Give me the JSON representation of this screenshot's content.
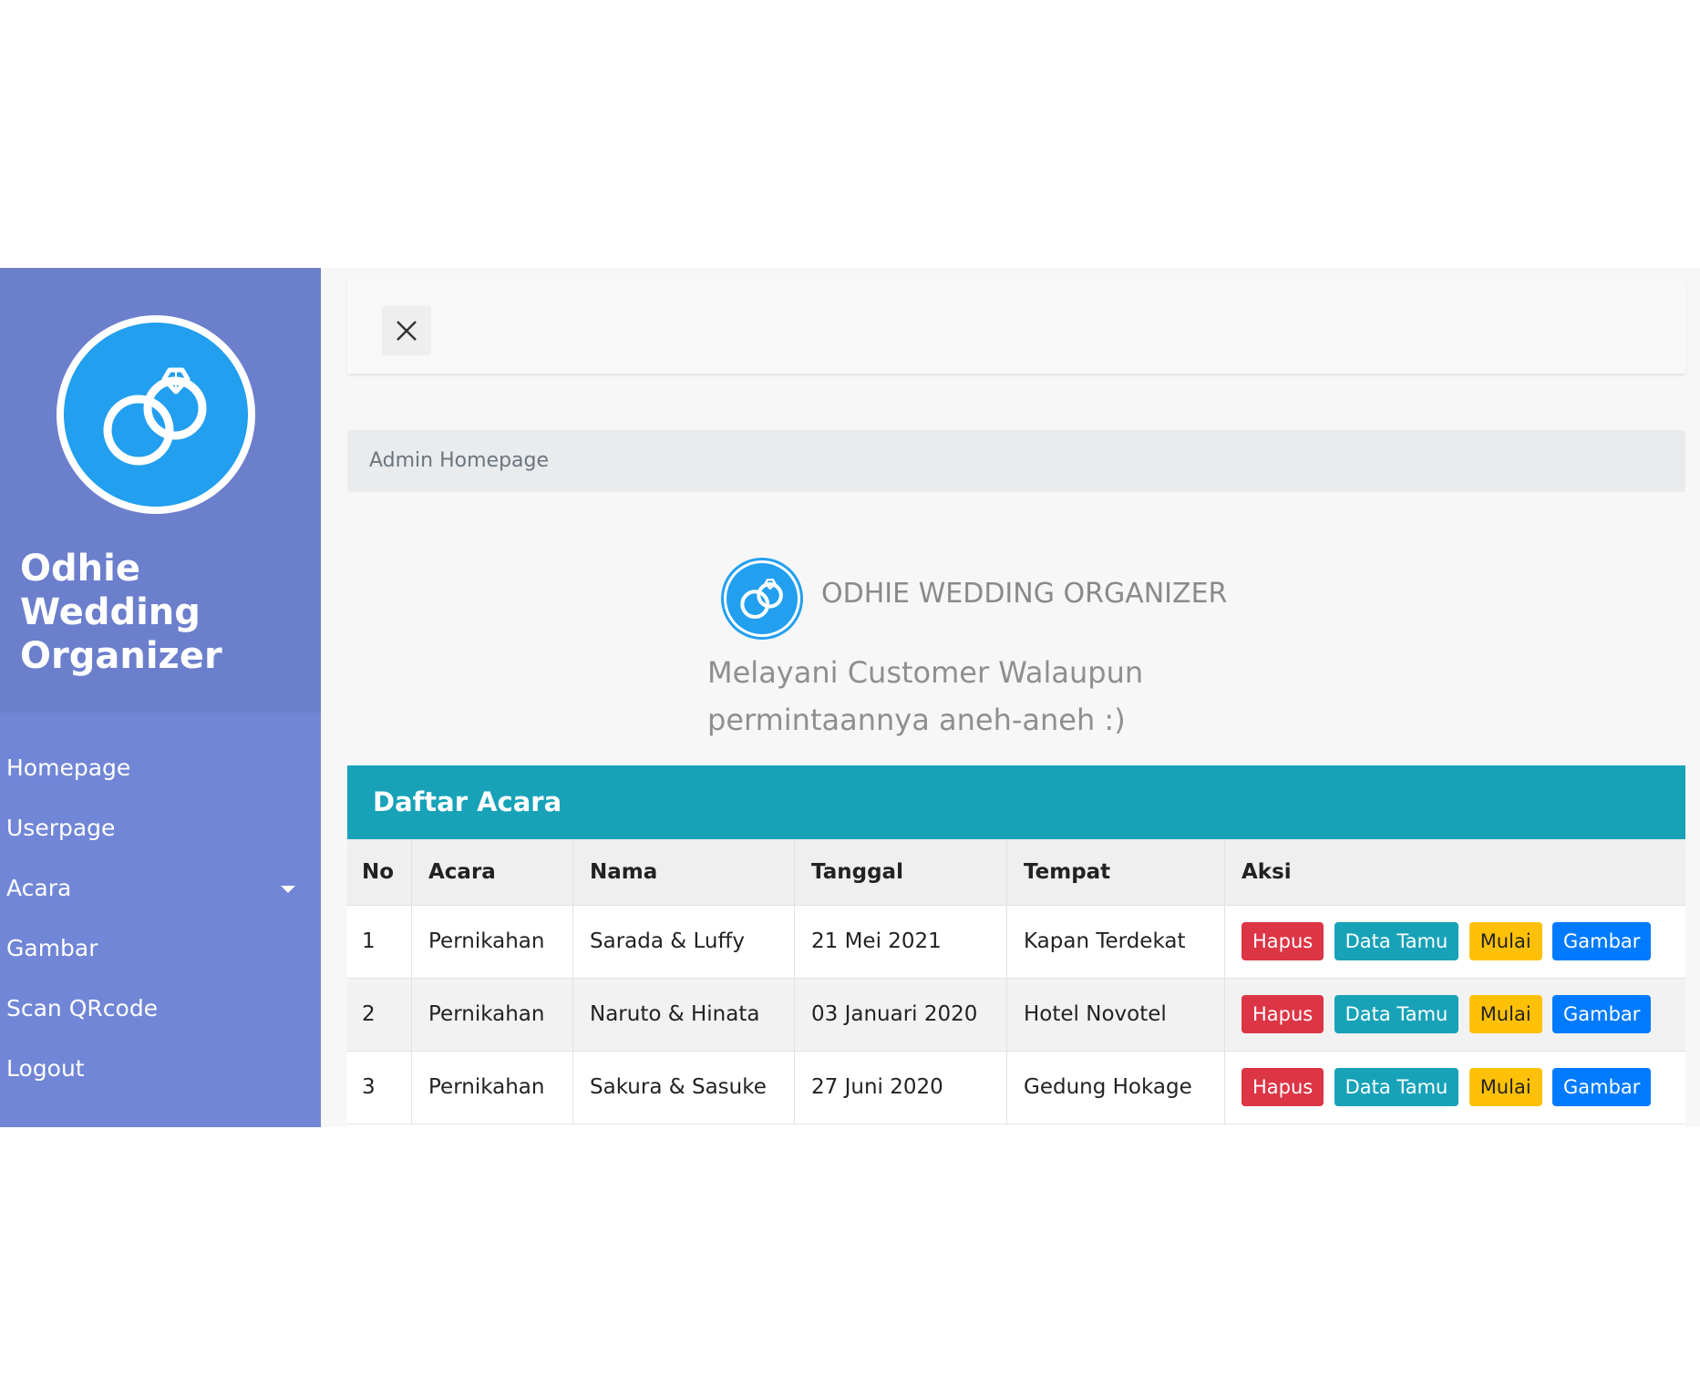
{
  "sidebar": {
    "brand_line1": "Odhie",
    "brand_line2": "Wedding",
    "brand_line3": "Organizer",
    "logo_icon": "wedding-rings-icon",
    "items": [
      {
        "label": "Homepage"
      },
      {
        "label": "Userpage"
      },
      {
        "label": "Acara",
        "has_dropdown": true
      },
      {
        "label": "Gambar"
      },
      {
        "label": "Scan QRcode"
      },
      {
        "label": "Logout"
      }
    ]
  },
  "topbar": {
    "close_icon": "close-icon"
  },
  "breadcrumb": {
    "text": "Admin Homepage"
  },
  "hero": {
    "title": "ODHIE WEDDING ORGANIZER",
    "tagline_line1": "Melayani Customer Walaupun",
    "tagline_line2": "permintaannya aneh-aneh :)"
  },
  "events_card": {
    "title": "Daftar Acara",
    "columns": [
      "No",
      "Acara",
      "Nama",
      "Tanggal",
      "Tempat",
      "Aksi"
    ],
    "rows": [
      {
        "no": "1",
        "acara": "Pernikahan",
        "nama": "Sarada & Luffy",
        "tanggal": "21 Mei 2021",
        "tempat": "Kapan Terdekat"
      },
      {
        "no": "2",
        "acara": "Pernikahan",
        "nama": "Naruto & Hinata",
        "tanggal": "03 Januari 2020",
        "tempat": "Hotel Novotel"
      },
      {
        "no": "3",
        "acara": "Pernikahan",
        "nama": "Sakura & Sasuke",
        "tanggal": "27 Juni 2020",
        "tempat": "Gedung Hokage"
      }
    ],
    "actions": {
      "delete": "Hapus",
      "guests": "Data Tamu",
      "start": "Mulai",
      "images": "Gambar"
    }
  },
  "colors": {
    "sidebar": "#7186d6",
    "sidebar_header": "#6b7fcc",
    "logo_blue": "#229fef",
    "card_header": "#17a2b8",
    "danger": "#dc3545",
    "info": "#17a2b8",
    "warning": "#ffc107",
    "primary": "#007bff"
  }
}
